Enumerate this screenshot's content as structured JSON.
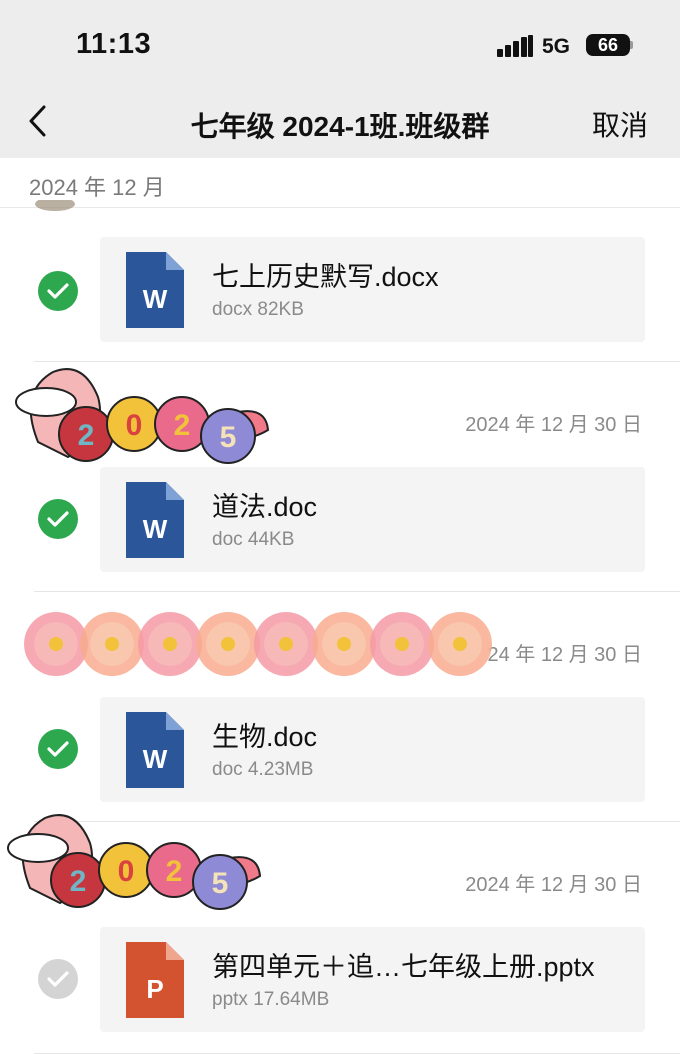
{
  "status_bar": {
    "time": "11:13",
    "network": "5G",
    "battery": "66"
  },
  "nav": {
    "title": "七年级 2024-1班.班级群",
    "cancel_label": "取消"
  },
  "month_header": "2024 年 12 月",
  "files": [
    {
      "name": "七上历史默写.docx",
      "meta": "docx 82KB",
      "type": "word",
      "icon_letter": "W",
      "selected": true,
      "date": ""
    },
    {
      "name": "道法.doc",
      "meta": "doc 44KB",
      "type": "word",
      "icon_letter": "W",
      "selected": true,
      "date": "2024 年 12 月 30 日"
    },
    {
      "name": "生物.doc",
      "meta": "doc 4.23MB",
      "type": "word",
      "icon_letter": "W",
      "selected": true,
      "date": "24 年 12 月 30 日"
    },
    {
      "name": "第四单元＋追…七年级上册.pptx",
      "meta": "pptx 17.64MB",
      "type": "powerpoint",
      "icon_letter": "P",
      "selected": false,
      "date": "2024 年 12 月 30 日"
    }
  ],
  "stickers": {
    "snail_text": "2025"
  },
  "colors": {
    "check_on": "#2ea84f",
    "check_off": "#d4d4d4",
    "word_blue": "#2b579a",
    "ppt_orange": "#d35230"
  },
  "icons": [
    "back-chevron-icon",
    "signal-icon",
    "battery-icon",
    "checkmark-icon",
    "word-file-icon",
    "powerpoint-file-icon"
  ]
}
